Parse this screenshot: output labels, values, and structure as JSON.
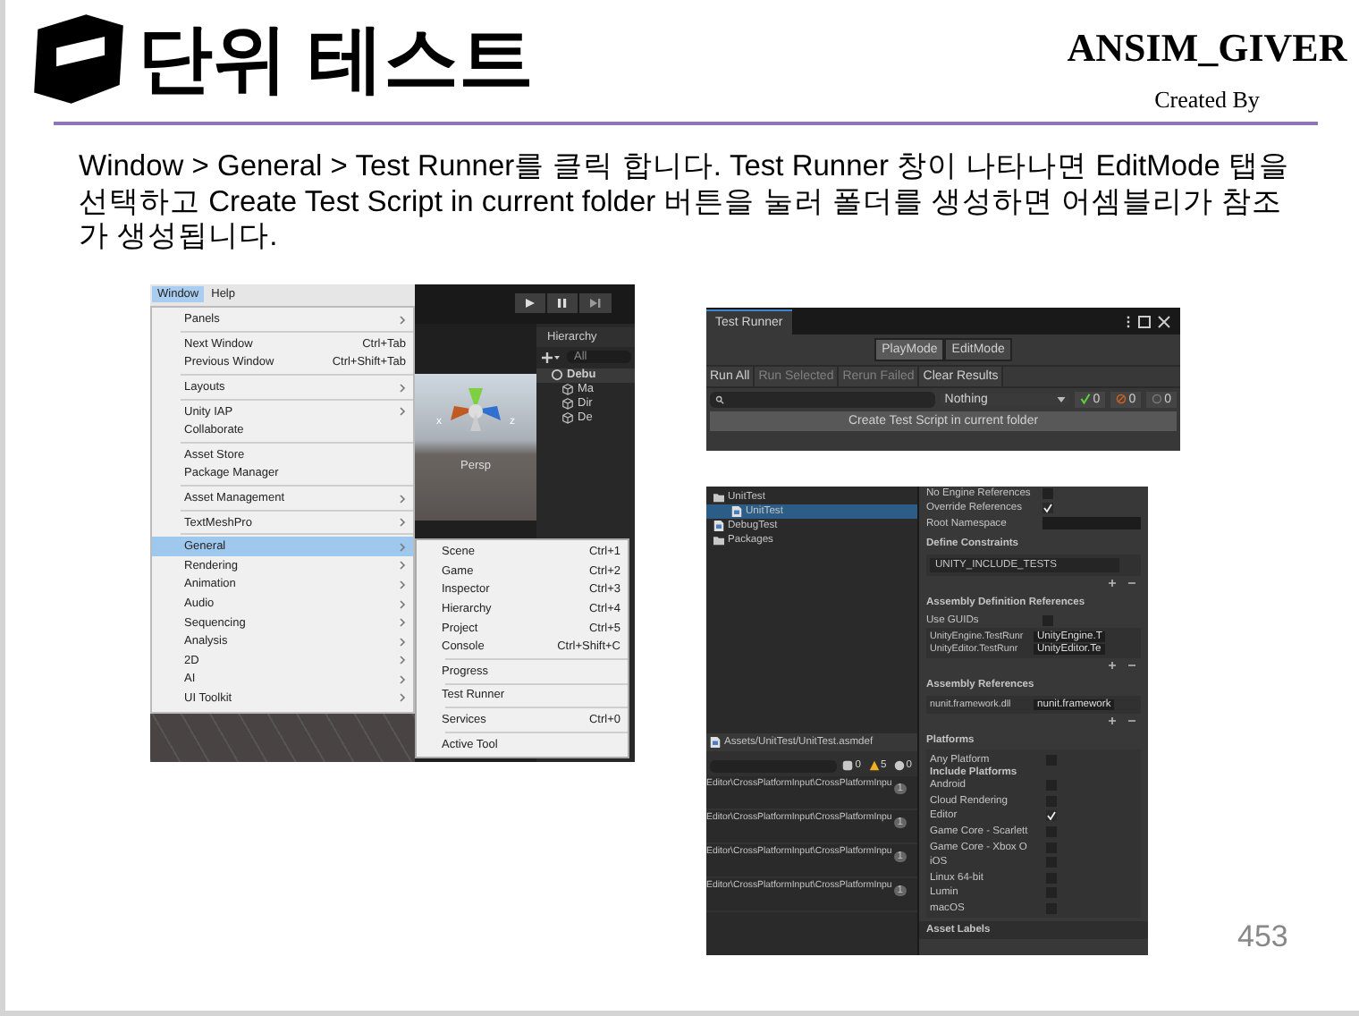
{
  "header": {
    "title": "단위 테스트",
    "author": "ANSIM_GIVER",
    "credit": "Created By"
  },
  "instructions": "Window > General > Test Runner를 클릭 합니다. Test Runner 창이 나타나면 EditMode 탭을 선택하고 Create Test Script in current folder 버튼을 눌러 폴더를 생성하면 어셈블리가 참조가 생성됩니다.",
  "menu_screenshot": {
    "menu_bar": [
      {
        "label": "Window",
        "selected": true
      },
      {
        "label": "Help",
        "selected": false
      }
    ],
    "menu_groups": [
      [
        {
          "label": "Panels",
          "submenu": true,
          "selected": false
        }
      ],
      [
        {
          "label": "Next Window",
          "shortcut": "Ctrl+Tab",
          "submenu": false,
          "selected": false
        },
        {
          "label": "Previous Window",
          "shortcut": "Ctrl+Shift+Tab",
          "submenu": false,
          "selected": false
        }
      ],
      [
        {
          "label": "Layouts",
          "submenu": true,
          "selected": false
        }
      ],
      [
        {
          "label": "Unity IAP",
          "submenu": true,
          "selected": false
        },
        {
          "label": "Collaborate",
          "submenu": false,
          "selected": false
        }
      ],
      [
        {
          "label": "Asset Store",
          "submenu": false,
          "selected": false
        },
        {
          "label": "Package Manager",
          "submenu": false,
          "selected": false
        }
      ],
      [
        {
          "label": "Asset Management",
          "submenu": true,
          "selected": false
        }
      ],
      [
        {
          "label": "TextMeshPro",
          "submenu": true,
          "selected": false
        }
      ],
      [
        {
          "label": "General",
          "submenu": true,
          "selected": true
        },
        {
          "label": "Rendering",
          "submenu": true,
          "selected": false
        },
        {
          "label": "Animation",
          "submenu": true,
          "selected": false
        },
        {
          "label": "Audio",
          "submenu": true,
          "selected": false
        },
        {
          "label": "Sequencing",
          "submenu": true,
          "selected": false
        },
        {
          "label": "Analysis",
          "submenu": true,
          "selected": false
        },
        {
          "label": "2D",
          "submenu": true,
          "selected": false
        },
        {
          "label": "AI",
          "submenu": true,
          "selected": false
        },
        {
          "label": "UI Toolkit",
          "submenu": true,
          "selected": false
        }
      ]
    ],
    "submenu_groups": [
      [
        {
          "label": "Scene",
          "shortcut": "Ctrl+1"
        },
        {
          "label": "Game",
          "shortcut": "Ctrl+2"
        },
        {
          "label": "Inspector",
          "shortcut": "Ctrl+3"
        },
        {
          "label": "Hierarchy",
          "shortcut": "Ctrl+4"
        },
        {
          "label": "Project",
          "shortcut": "Ctrl+5"
        },
        {
          "label": "Console",
          "shortcut": "Ctrl+Shift+C"
        }
      ],
      [
        {
          "label": "Progress"
        }
      ],
      [
        {
          "label": "Test Runner"
        }
      ],
      [
        {
          "label": "Services",
          "shortcut": "Ctrl+0"
        }
      ],
      [
        {
          "label": "Active Tool"
        }
      ]
    ],
    "hierarchy_title": "Hierarchy",
    "hierarchy_search": "All",
    "hierarchy_items": [
      {
        "label": "Debu",
        "kind": "scene"
      },
      {
        "label": "Ma",
        "kind": "object"
      },
      {
        "label": "Dir",
        "kind": "object"
      },
      {
        "label": "De",
        "kind": "object"
      }
    ],
    "gizmo_axes": [
      "x",
      "z"
    ],
    "scene_label": "Persp"
  },
  "test_runner": {
    "title": "Test Runner",
    "modes": [
      {
        "label": "PlayMode",
        "selected": true
      },
      {
        "label": "EditMode",
        "selected": false
      }
    ],
    "actions": [
      {
        "label": "Run All",
        "disabled": false
      },
      {
        "label": "Run Selected",
        "disabled": true
      },
      {
        "label": "Rerun Failed",
        "disabled": true
      },
      {
        "label": "Clear Results",
        "disabled": false
      }
    ],
    "filter": "Nothing",
    "counts": [
      {
        "kind": "passed",
        "count": "0"
      },
      {
        "kind": "failed",
        "count": "0"
      },
      {
        "kind": "skipped",
        "count": "0"
      }
    ],
    "create_button": "Create Test Script in current folder"
  },
  "inspector_screenshot": {
    "project_tree": [
      {
        "label": "UnitTest",
        "kind": "folder",
        "selected": false,
        "children": [
          {
            "label": "UnitTest",
            "kind": "file",
            "selected": true
          }
        ]
      },
      {
        "label": "DebugTest",
        "kind": "file",
        "selected": false
      },
      {
        "label": "Packages",
        "kind": "folder",
        "selected": false
      }
    ],
    "asset_path": "Assets/UnitTest/UnitTest.asmdef",
    "console_counts": [
      {
        "kind": "info",
        "count": "0"
      },
      {
        "kind": "warning",
        "count": "5"
      },
      {
        "kind": "error",
        "count": "0"
      }
    ],
    "console_rows": [
      {
        "text": "Editor\\CrossPlatformInput\\CrossPlatformInpu",
        "count": "1"
      },
      {
        "text": "Editor\\CrossPlatformInput\\CrossPlatformInpu",
        "count": "1"
      },
      {
        "text": "Editor\\CrossPlatformInput\\CrossPlatformInpu",
        "count": "1"
      },
      {
        "text": "Editor\\CrossPlatformInput\\CrossPlatformInpu",
        "count": "1"
      }
    ],
    "toggles": [
      {
        "label": "No Engine References",
        "checked": false
      },
      {
        "label": "Override References",
        "checked": true
      }
    ],
    "root_namespace": "Root Namespace",
    "define_constraints": {
      "title": "Define Constraints",
      "items": [
        "UNITY_INCLUDE_TESTS"
      ]
    },
    "assembly_definition_references": {
      "title": "Assembly Definition References",
      "use_guids": {
        "label": "Use GUIDs",
        "checked": false
      },
      "items": [
        {
          "name": "UnityEngine.TestRunr",
          "value": "UnityEngine.T"
        },
        {
          "name": "UnityEditor.TestRunr",
          "value": "UnityEditor.Te"
        }
      ]
    },
    "assembly_references": {
      "title": "Assembly References",
      "items": [
        {
          "name": "nunit.framework.dll",
          "value": "nunit.framework"
        }
      ]
    },
    "platforms": {
      "title": "Platforms",
      "any_platform": {
        "label": "Any Platform",
        "checked": false
      },
      "include_title": "Include Platforms",
      "items": [
        {
          "label": "Android",
          "checked": false
        },
        {
          "label": "Cloud Rendering",
          "checked": false
        },
        {
          "label": "Editor",
          "checked": true
        },
        {
          "label": "Game Core - Scarlett",
          "checked": false
        },
        {
          "label": "Game Core - Xbox O",
          "checked": false
        },
        {
          "label": "iOS",
          "checked": false
        },
        {
          "label": "Linux 64-bit",
          "checked": false
        },
        {
          "label": "Lumin",
          "checked": false
        },
        {
          "label": "macOS",
          "checked": false
        }
      ]
    },
    "asset_labels": "Asset Labels"
  },
  "page_number": "453"
}
